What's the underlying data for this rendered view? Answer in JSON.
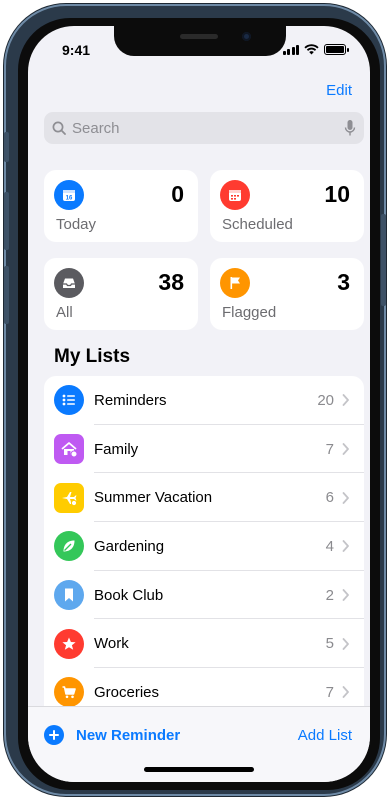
{
  "status": {
    "time": "9:41"
  },
  "header": {
    "edit_label": "Edit"
  },
  "search": {
    "placeholder": "Search"
  },
  "summary": [
    {
      "label": "Today",
      "count": "0",
      "color": "#0a7aff",
      "icon": "calendar-icon"
    },
    {
      "label": "Scheduled",
      "count": "10",
      "color": "#ff3b30",
      "icon": "calendar-grid-icon"
    },
    {
      "label": "All",
      "count": "38",
      "color": "#5b5b60",
      "icon": "tray-icon"
    },
    {
      "label": "Flagged",
      "count": "3",
      "color": "#ff9500",
      "icon": "flag-icon"
    }
  ],
  "my_lists": {
    "title": "My Lists",
    "items": [
      {
        "name": "Reminders",
        "count": "20",
        "color": "#0a7aff",
        "icon": "list-bullet-icon"
      },
      {
        "name": "Family",
        "count": "7",
        "color": "#bf5af2",
        "icon": "house-icon"
      },
      {
        "name": "Summer Vacation",
        "count": "6",
        "color": "#ffcc00",
        "icon": "airplane-icon"
      },
      {
        "name": "Gardening",
        "count": "4",
        "color": "#34c759",
        "icon": "leaf-icon"
      },
      {
        "name": "Book Club",
        "count": "2",
        "color": "#5ea8ee",
        "icon": "bookmark-icon"
      },
      {
        "name": "Work",
        "count": "5",
        "color": "#ff3b30",
        "icon": "star-icon"
      },
      {
        "name": "Groceries",
        "count": "7",
        "color": "#ff9500",
        "icon": "cart-icon"
      }
    ]
  },
  "toolbar": {
    "new_reminder_label": "New Reminder",
    "add_list_label": "Add List"
  }
}
